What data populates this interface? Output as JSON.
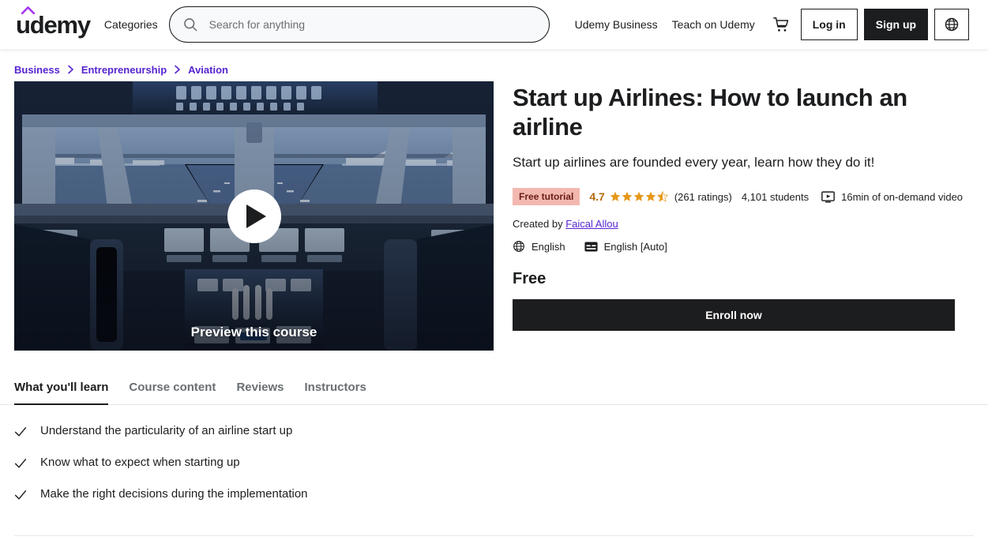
{
  "header": {
    "logo_text": "udemy",
    "logo_accent_color": "#a435f0",
    "categories_label": "Categories",
    "search": {
      "placeholder": "Search for anything",
      "value": "",
      "icon": "search-icon"
    },
    "links": [
      {
        "label": "Udemy Business"
      },
      {
        "label": "Teach on Udemy"
      }
    ],
    "cart_icon": "shopping-cart-icon",
    "login_label": "Log in",
    "signup_label": "Sign up",
    "language_icon": "globe-icon"
  },
  "breadcrumb": {
    "items": [
      {
        "label": "Business"
      },
      {
        "label": "Entrepreneurship"
      },
      {
        "label": "Aviation"
      }
    ],
    "separator_icon": "chevron-right-icon",
    "link_color": "#5624d0"
  },
  "video_preview": {
    "play_icon": "play-icon",
    "caption": "Preview this course",
    "alt": "airplane cockpit with runway view through windshield"
  },
  "course": {
    "title": "Start up Airlines: How to launch an airline",
    "subtitle": "Start up airlines are founded every year, learn how they do it!",
    "badge": "Free tutorial",
    "badge_bg": "#f2b8b0",
    "badge_text_color": "#6a1c14",
    "rating": "4.7",
    "star_color": "#e59819",
    "stars_filled": 4,
    "stars_half": 1,
    "ratings_count": "(261 ratings)",
    "students": "4,101 students",
    "video_icon": "video-monitor-icon",
    "video_length": "16min of on-demand video",
    "created_by_label": "Created by",
    "author": "Faical Allou",
    "author_color": "#5624d0",
    "globe_icon": "globe-icon",
    "language": "English",
    "captions_icon": "closed-caption-icon",
    "captions": "English [Auto]",
    "price": "Free",
    "enroll_label": "Enroll now",
    "enroll_bg": "#1c1d1f"
  },
  "tabs": [
    {
      "label": "What you'll learn",
      "active": true
    },
    {
      "label": "Course content",
      "active": false
    },
    {
      "label": "Reviews",
      "active": false
    },
    {
      "label": "Instructors",
      "active": false
    }
  ],
  "objectives": {
    "check_icon": "check-icon",
    "items": [
      {
        "text": "Understand the particularity of an airline start up"
      },
      {
        "text": "Know what to expect when starting up"
      },
      {
        "text": "Make the right decisions during the implementation"
      }
    ]
  }
}
